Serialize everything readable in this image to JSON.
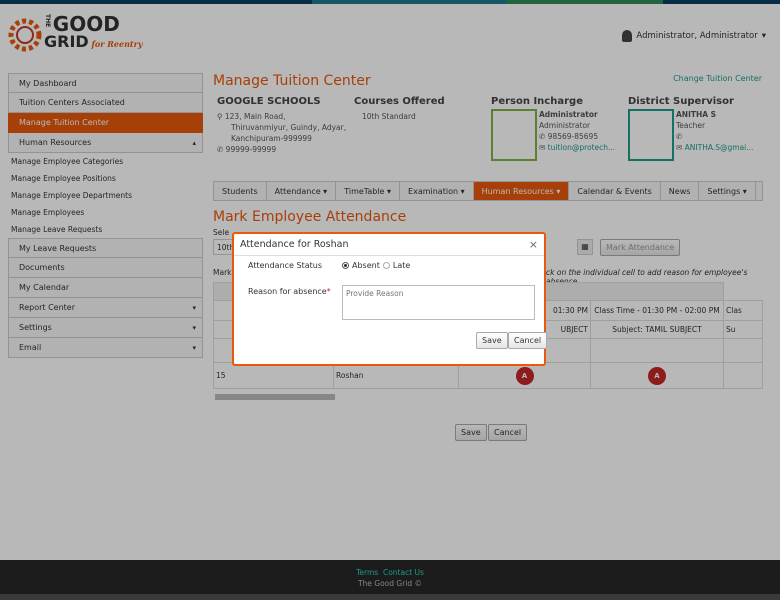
{
  "header": {
    "logo_the": "THE",
    "logo_good": "GOOD",
    "logo_grid": "GRID",
    "logo_tag": "for Reentry",
    "user": "Administrator, Administrator"
  },
  "sidebar": {
    "items": [
      "My Dashboard",
      "Tuition Centers Associated",
      "Manage Tuition Center",
      "Human Resources"
    ],
    "subitems": [
      "Manage Employee Categories",
      "Manage Employee Positions",
      "Manage Employee Departments",
      "Manage Employees",
      "Manage Leave Requests"
    ],
    "items2": [
      "My Leave Requests",
      "Documents",
      "My Calendar",
      "Report Center",
      "Settings",
      "Email"
    ]
  },
  "main": {
    "title": "Manage Tuition Center",
    "change": "Change Tuition Center",
    "school": {
      "name": "GOOGLE SCHOOLS",
      "addr1": "123, Main Road,",
      "addr2": "Thiruvanmiyur, Guindy, Adyar,",
      "addr3": "Kanchipuram-999999",
      "phone": "99999-99999"
    },
    "courses": {
      "title": "Courses Offered",
      "value": "10th Standard"
    },
    "incharge": {
      "title": "Person Incharge",
      "name": "Administrator",
      "role": "Administrator",
      "phone": "98569-85695",
      "email": "tuition@protech..."
    },
    "district": {
      "title": "District Supervisor",
      "name": "ANITHA S",
      "role": "Teacher",
      "email": "ANITHA.S@gmai..."
    }
  },
  "tabs": [
    "Students",
    "Attendance ▾",
    "TimeTable ▾",
    "Examination ▾",
    "Human Resources ▾",
    "Calendar & Events",
    "News",
    "Settings ▾"
  ],
  "attendance": {
    "title": "Mark Employee Attendance",
    "sel_label": "Sele",
    "sel_value": "10th",
    "mark_btn": "Mark Attendance",
    "mark_label": "Mark",
    "hint": "ck on the individual cell to add reason for employee's absence",
    "col2_time": "01:30 PM",
    "col2_sub": "UBJECT",
    "col3_time": "Class Time - 01:30 PM - 02:00 PM",
    "col3_sub": "Subject: TAMIL SUBJECT",
    "col4_time": "Clas",
    "col4_sub": "Su",
    "row_id": "15",
    "row_name": "Roshan",
    "a1": "A",
    "a2": "A",
    "save": "Save",
    "cancel": "Cancel"
  },
  "modal": {
    "title": "Attendance for Roshan",
    "close": "×",
    "status_label": "Attendance Status",
    "absent": "Absent",
    "late": "Late",
    "reason_label": "Reason for absence",
    "required": "*",
    "reason_placeholder": "Provide Reason",
    "save": "Save",
    "cancel": "Cancel"
  },
  "footer": {
    "terms": "Terms",
    "contact": "Contact Us",
    "copy": "The Good Grid ©"
  }
}
